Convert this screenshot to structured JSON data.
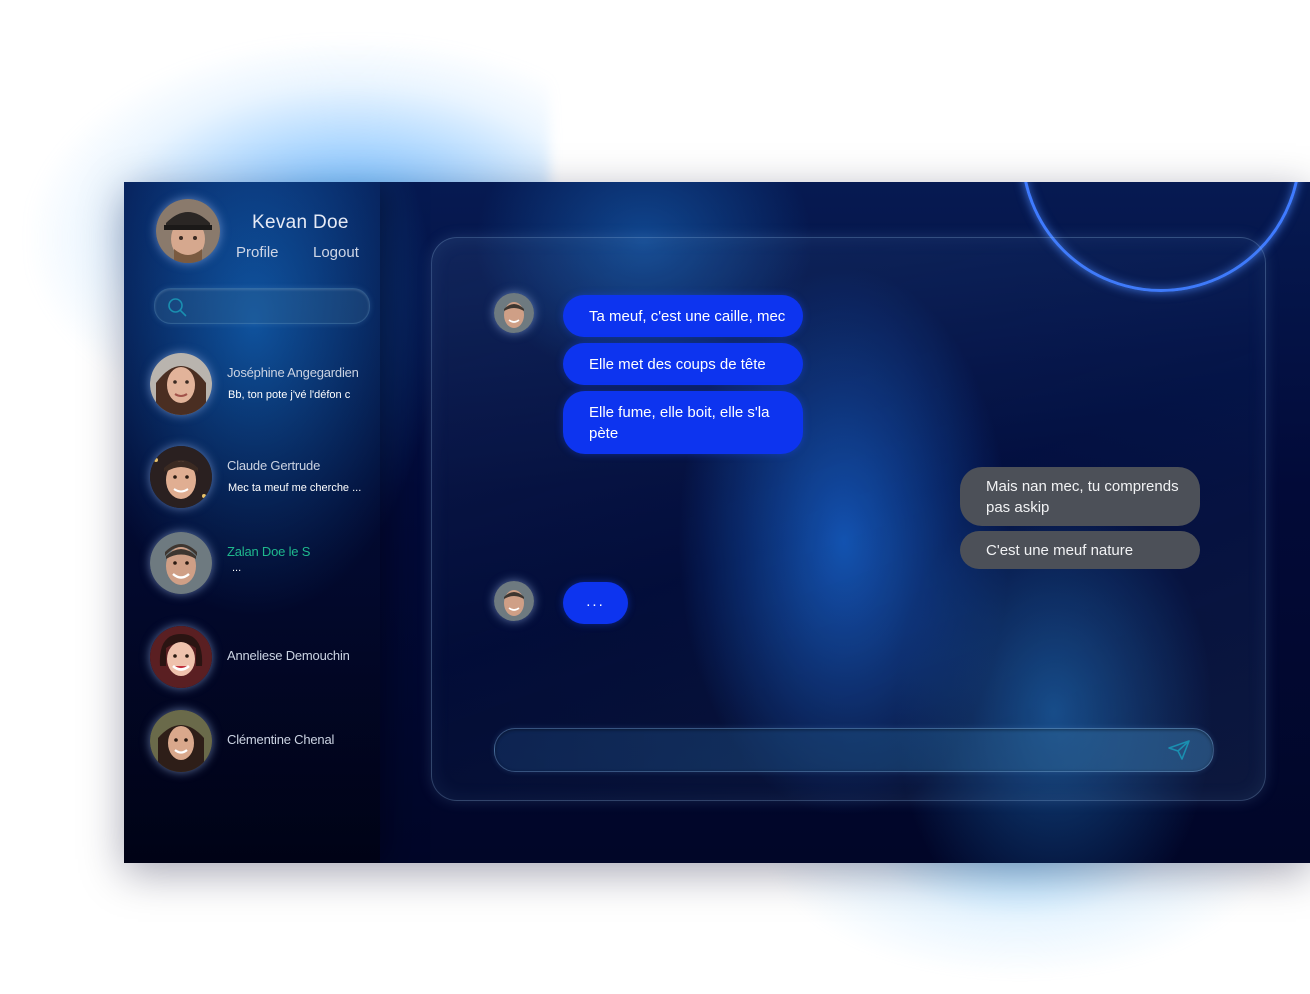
{
  "user": {
    "name": "Kevan Doe",
    "profile_label": "Profile",
    "logout_label": "Logout"
  },
  "search": {
    "placeholder": "",
    "value": ""
  },
  "contacts": [
    {
      "name": "Joséphine Angegardien",
      "preview": "Bb, ton pote j'vé l'défon c",
      "active": false
    },
    {
      "name": "Claude Gertrude",
      "preview": "Mec ta meuf me cherche ...",
      "active": false
    },
    {
      "name": "Zalan Doe le S",
      "preview": "...",
      "active": true
    },
    {
      "name": "Anneliese Demouchin",
      "preview": "",
      "active": false
    },
    {
      "name": "Clémentine Chenal",
      "preview": "",
      "active": false
    }
  ],
  "conversation": {
    "incoming_group_1": [
      "Ta meuf, c'est une caille, mec",
      "Elle met des coups de tête",
      "Elle fume, elle boit, elle s'la pète"
    ],
    "outgoing_group": [
      "Mais nan mec, tu comprends pas askip",
      "C'est une meuf nature"
    ],
    "typing_indicator": "..."
  },
  "composer": {
    "placeholder": "",
    "value": ""
  },
  "icons": {
    "search": "search-icon",
    "send": "send-icon"
  },
  "colors": {
    "incoming_bubble": "#0d34ef",
    "outgoing_bubble": "#4c5058",
    "active_contact": "#1fb88d",
    "ring_accent": "#3f7bff",
    "icon_teal": "#1a8fb0"
  }
}
